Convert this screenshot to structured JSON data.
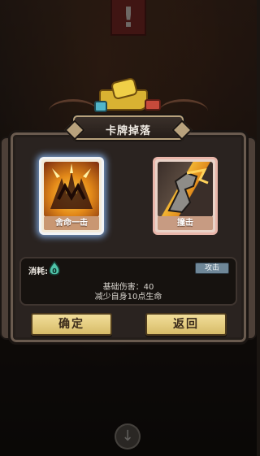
{
  "header": {
    "faded_text": "",
    "alert_mark": "!"
  },
  "dialog": {
    "title": "卡牌掉落"
  },
  "cards": [
    {
      "name": "舍命一击"
    },
    {
      "name": "撞击"
    }
  ],
  "info": {
    "cost_label": "消耗:",
    "cost_value": "0",
    "type_tag": "攻击",
    "desc_line1": "基础伤害：40",
    "desc_line2": "减少自身10点生命"
  },
  "buttons": {
    "confirm": "确定",
    "back": "返回"
  },
  "colors": {
    "title_border": "#b8a27d",
    "button_fill": "#f2de9a",
    "cost_icon": "#4fc3a8",
    "selected_glow": "#8cbeff"
  },
  "icons": {
    "alert": "exclamation-icon",
    "cost": "energy-flame-icon",
    "scroll": "arrow-down-icon"
  }
}
